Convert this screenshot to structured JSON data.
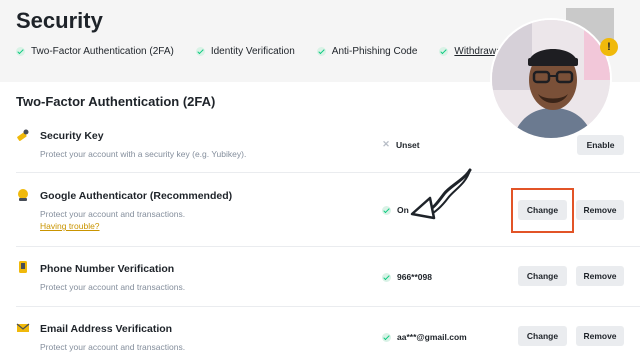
{
  "header": {
    "title": "Security",
    "statuses": [
      {
        "label": "Two-Factor Authentication (2FA)"
      },
      {
        "label": "Identity Verification"
      },
      {
        "label": "Anti-Phishing Code"
      },
      {
        "label": "Withdrawal Whitelist"
      }
    ]
  },
  "section": {
    "title": "Two-Factor Authentication (2FA)"
  },
  "methods": [
    {
      "title": "Security Key",
      "description": "Protect your account with a security key (e.g. Yubikey).",
      "state": "Unset",
      "enabled": false,
      "buttons": [
        "Enable"
      ],
      "icon": "key-icon"
    },
    {
      "title": "Google Authenticator (Recommended)",
      "description": "Protect your account and transactions.",
      "help_link": "Having trouble?",
      "state": "On",
      "enabled": true,
      "buttons": [
        "Change",
        "Remove"
      ],
      "icon": "authenticator-icon"
    },
    {
      "title": "Phone Number Verification",
      "description": "Protect your account and transactions.",
      "state": "966**098",
      "enabled": true,
      "buttons": [
        "Change",
        "Remove"
      ],
      "icon": "phone-icon"
    },
    {
      "title": "Email Address Verification",
      "description": "Protect your account and transactions.",
      "state": "aa***@gmail.com",
      "enabled": true,
      "buttons": [
        "Change",
        "Remove"
      ],
      "icon": "email-icon"
    }
  ],
  "overlay": {
    "badge": "!",
    "highlight_color": "#e25427"
  },
  "colors": {
    "accent_gold": "#c99400",
    "success_green": "#0ecb81",
    "muted_text": "#848e9c"
  }
}
